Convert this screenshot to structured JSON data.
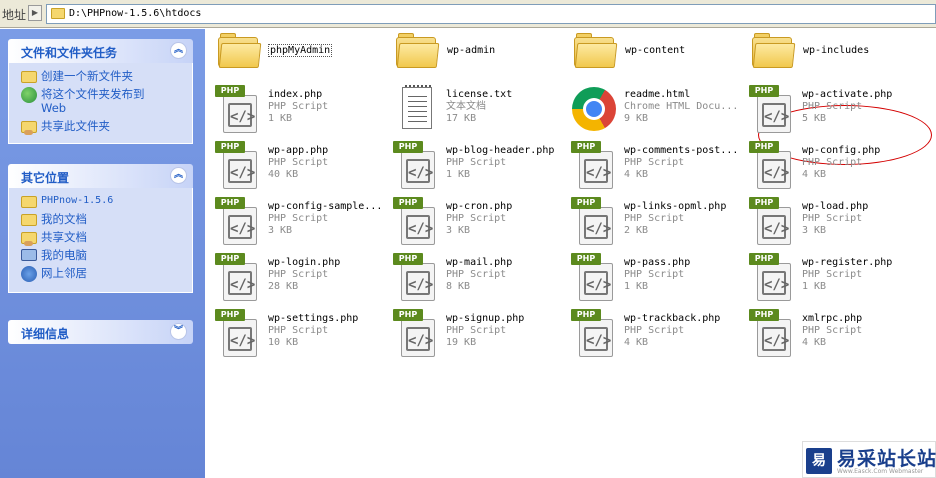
{
  "address": {
    "label": "地址",
    "path": "D:\\PHPnow-1.5.6\\htdocs"
  },
  "tasks_panel": {
    "title": "文件和文件夹任务",
    "items": [
      {
        "label": "创建一个新文件夹",
        "icon": "new-folder-icon"
      },
      {
        "label": "将这个文件夹发布到 Web",
        "icon": "publish-web-icon"
      },
      {
        "label": "共享此文件夹",
        "icon": "share-folder-icon"
      }
    ]
  },
  "places_panel": {
    "title": "其它位置",
    "items": [
      {
        "label": "PHPnow-1.5.6",
        "icon": "folder-icon"
      },
      {
        "label": "我的文档",
        "icon": "my-documents-icon"
      },
      {
        "label": "共享文档",
        "icon": "shared-documents-icon"
      },
      {
        "label": "我的电脑",
        "icon": "my-computer-icon"
      },
      {
        "label": "网上邻居",
        "icon": "network-places-icon"
      }
    ]
  },
  "details_panel": {
    "title": "详细信息"
  },
  "files": [
    {
      "name": "phpMyAdmin",
      "kind": "folder"
    },
    {
      "name": "wp-admin",
      "kind": "folder"
    },
    {
      "name": "wp-content",
      "kind": "folder"
    },
    {
      "name": "wp-includes",
      "kind": "folder"
    },
    {
      "name": "index.php",
      "type": "PHP Script",
      "size": "1 KB",
      "kind": "php"
    },
    {
      "name": "license.txt",
      "type": "文本文档",
      "size": "17 KB",
      "kind": "txt"
    },
    {
      "name": "readme.html",
      "type": "Chrome HTML Docu...",
      "size": "9 KB",
      "kind": "chrome"
    },
    {
      "name": "wp-activate.php",
      "type": "PHP Script",
      "size": "5 KB",
      "kind": "php"
    },
    {
      "name": "wp-app.php",
      "type": "PHP Script",
      "size": "40 KB",
      "kind": "php"
    },
    {
      "name": "wp-blog-header.php",
      "type": "PHP Script",
      "size": "1 KB",
      "kind": "php"
    },
    {
      "name": "wp-comments-post...",
      "type": "PHP Script",
      "size": "4 KB",
      "kind": "php"
    },
    {
      "name": "wp-config.php",
      "type": "PHP Script",
      "size": "4 KB",
      "kind": "php"
    },
    {
      "name": "wp-config-sample...",
      "type": "PHP Script",
      "size": "3 KB",
      "kind": "php"
    },
    {
      "name": "wp-cron.php",
      "type": "PHP Script",
      "size": "3 KB",
      "kind": "php"
    },
    {
      "name": "wp-links-opml.php",
      "type": "PHP Script",
      "size": "2 KB",
      "kind": "php"
    },
    {
      "name": "wp-load.php",
      "type": "PHP Script",
      "size": "3 KB",
      "kind": "php"
    },
    {
      "name": "wp-login.php",
      "type": "PHP Script",
      "size": "28 KB",
      "kind": "php"
    },
    {
      "name": "wp-mail.php",
      "type": "PHP Script",
      "size": "8 KB",
      "kind": "php"
    },
    {
      "name": "wp-pass.php",
      "type": "PHP Script",
      "size": "1 KB",
      "kind": "php"
    },
    {
      "name": "wp-register.php",
      "type": "PHP Script",
      "size": "1 KB",
      "kind": "php"
    },
    {
      "name": "wp-settings.php",
      "type": "PHP Script",
      "size": "10 KB",
      "kind": "php"
    },
    {
      "name": "wp-signup.php",
      "type": "PHP Script",
      "size": "19 KB",
      "kind": "php"
    },
    {
      "name": "wp-trackback.php",
      "type": "PHP Script",
      "size": "4 KB",
      "kind": "php"
    },
    {
      "name": "xmlrpc.php",
      "type": "PHP Script",
      "size": "4 KB",
      "kind": "php"
    }
  ],
  "php_badge": "PHP",
  "watermark": {
    "logo": "易",
    "text": "易采站长站",
    "sub": "Www.Easck.Com Webmaster"
  },
  "colors": {
    "pane_blue": "#6f8fdf",
    "link_blue": "#215dc6",
    "highlight_red": "#d40000"
  }
}
